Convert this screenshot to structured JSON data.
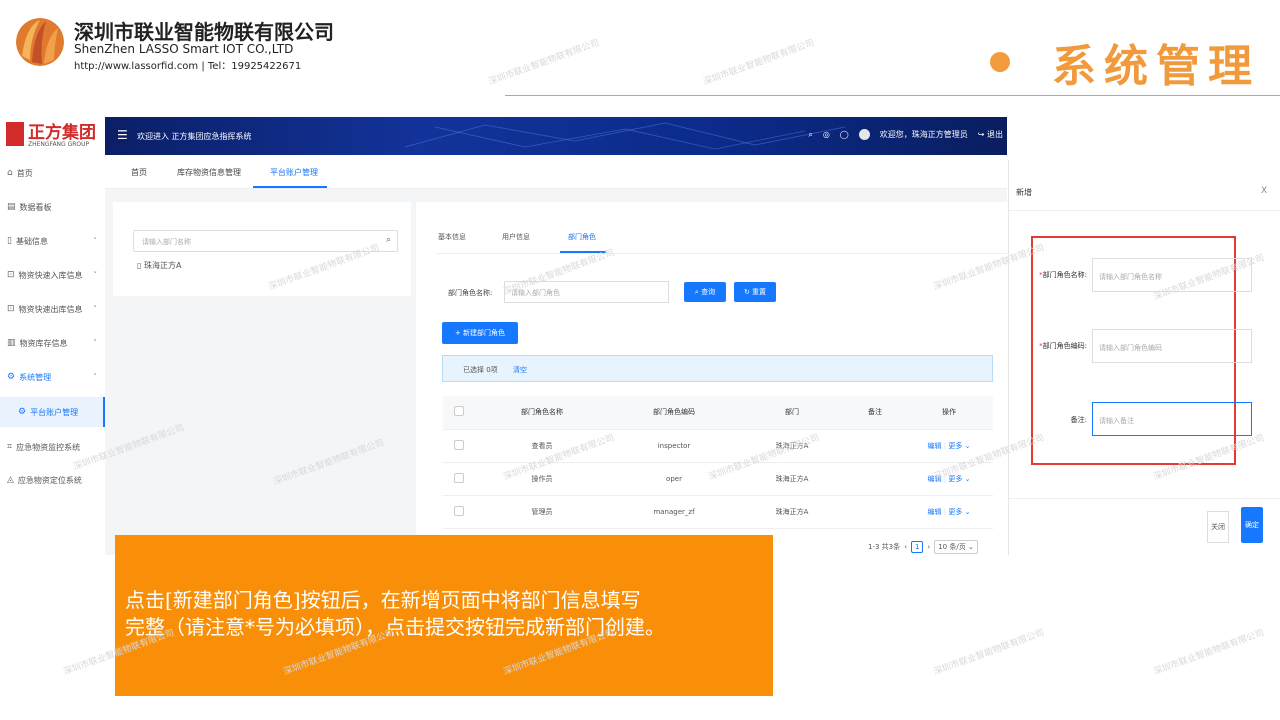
{
  "slide": {
    "company_cn": "深圳市联业智能物联有限公司",
    "company_en": "ShenZhen LASSO Smart IOT CO.,LTD",
    "company_web": "http://www.lassorfid.com | Tel：19925422671",
    "title": "系统管理",
    "accent_color": "#f09a3c",
    "watermark": "深圳市联业智能物联有限公司"
  },
  "app": {
    "brand_cn": "正方集团",
    "brand_en": "ZHENGFANG GROUP",
    "topbar": {
      "title": "欢迎进入 正方集团应急指挥系统",
      "greeting": "欢迎您，珠海正方管理员",
      "logout": "退出"
    },
    "sidebar": [
      {
        "icon": "home-icon",
        "glyph": "⌂",
        "label": "首页",
        "has_chevron": false
      },
      {
        "icon": "dashboard-icon",
        "glyph": "▤",
        "label": "数据看板",
        "has_chevron": false
      },
      {
        "icon": "document-icon",
        "glyph": "▯",
        "label": "基础信息",
        "has_chevron": true
      },
      {
        "icon": "inbound-icon",
        "glyph": "⊡",
        "label": "物资快速入库信息",
        "has_chevron": true
      },
      {
        "icon": "outbound-icon",
        "glyph": "⊡",
        "label": "物资快速出库信息",
        "has_chevron": true
      },
      {
        "icon": "stock-icon",
        "glyph": "▥",
        "label": "物资库存信息",
        "has_chevron": true
      },
      {
        "icon": "settings-icon",
        "glyph": "⚙",
        "label": "系统管理",
        "has_chevron": true,
        "expanded": true,
        "highlight": true
      },
      {
        "icon": "settings-icon",
        "glyph": "⚙",
        "label": "平台账户管理",
        "has_chevron": false,
        "active": true,
        "sub": true
      },
      {
        "icon": "monitor-icon",
        "glyph": "⌗",
        "label": "应急物资监控系统",
        "has_chevron": false
      },
      {
        "icon": "location-icon",
        "glyph": "◬",
        "label": "应急物资定位系统",
        "has_chevron": false
      }
    ],
    "tabs": [
      "首页",
      "库存物资信息管理",
      "平台账户管理"
    ],
    "active_tab": 2,
    "left_panel": {
      "search_placeholder": "请输入部门名称",
      "tree_node": "珠海正方A"
    },
    "right_panel": {
      "tabs": [
        "基本信息",
        "用户信息",
        "部门角色"
      ],
      "active_tab": 2,
      "role_name_label": "部门角色名称:",
      "role_name_placeholder": "请输入部门角色",
      "search_button": "查询",
      "reset_button": "重置",
      "new_button": "新建部门角色",
      "selected_text": "已选择 0项",
      "clear_text": "清空",
      "columns": [
        "部门角色名称",
        "部门角色编码",
        "部门",
        "备注",
        "操作"
      ],
      "rows": [
        {
          "name": "查看员",
          "code": "inspector",
          "dept": "珠海正方A",
          "remark": ""
        },
        {
          "name": "操作员",
          "code": "oper",
          "dept": "珠海正方A",
          "remark": ""
        },
        {
          "name": "管理员",
          "code": "manager_zf",
          "dept": "珠海正方A",
          "remark": ""
        }
      ],
      "edit_label": "编辑",
      "more_label": "更多",
      "pagination": {
        "summary": "1-3 共3条",
        "current": "1",
        "page_size": "10 条/页"
      }
    },
    "dialog": {
      "title": "新增",
      "fields": [
        {
          "label": "部门角色名称",
          "placeholder": "请输入部门角色名称",
          "required": true
        },
        {
          "label": "部门角色编码",
          "placeholder": "请输入部门角色编码",
          "required": true
        },
        {
          "label": "备注",
          "placeholder": "请输入备注",
          "required": false
        }
      ],
      "cancel": "关闭",
      "ok": "确定"
    }
  },
  "callout": {
    "text_line1": "点击[新建部门角色]按钮后，在新增页面中将部门信息填写",
    "text_line2": "完整（请注意*号为必填项），点击提交按钮完成新部门创建。",
    "background": "#f98f08"
  }
}
